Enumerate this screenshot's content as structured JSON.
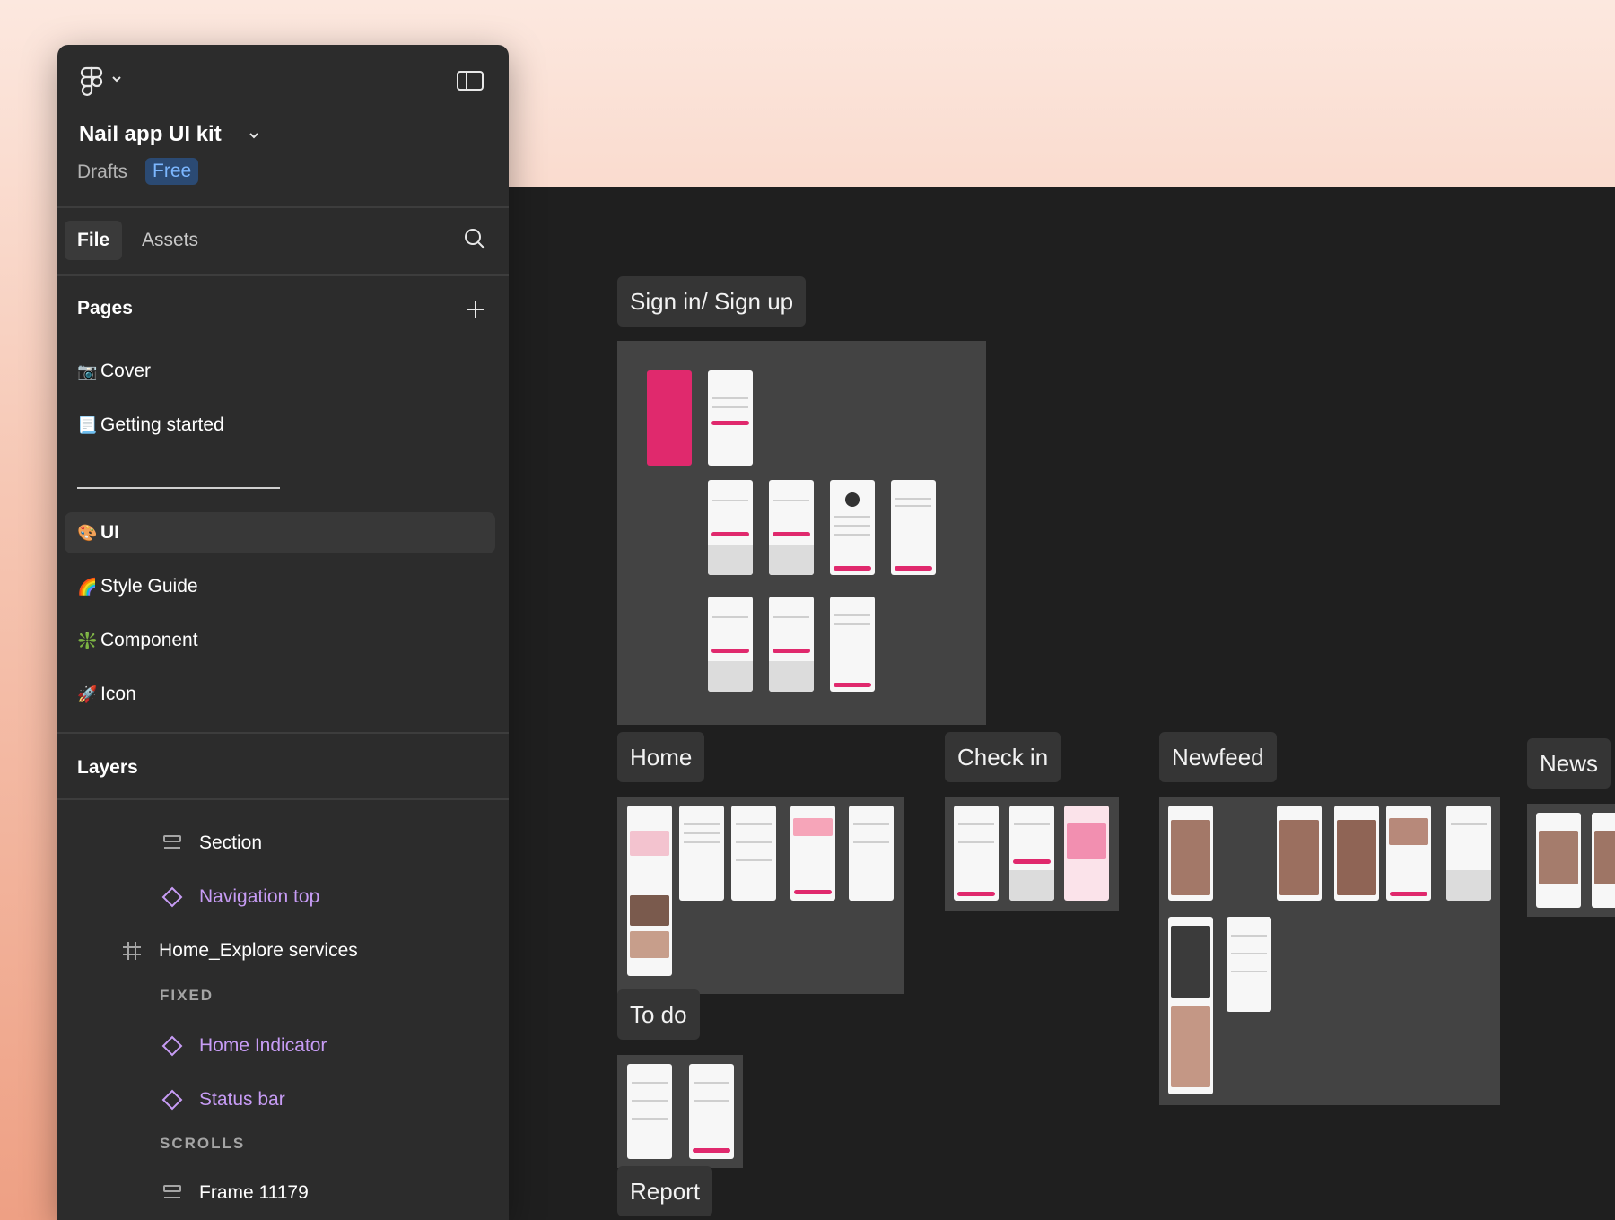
{
  "file": {
    "title": "Nail app UI kit",
    "location": "Drafts",
    "plan_badge": "Free"
  },
  "tabs": [
    {
      "label": "File"
    },
    {
      "label": "Assets"
    }
  ],
  "pages": {
    "heading": "Pages",
    "items": [
      {
        "icon": "📷",
        "label": "Cover"
      },
      {
        "icon": "📃",
        "label": "Getting started"
      },
      {
        "icon": "🎨",
        "label": "UI"
      },
      {
        "icon": "🌈",
        "label": "Style Guide"
      },
      {
        "icon": "❇️",
        "label": "Component"
      },
      {
        "icon": "🚀",
        "label": "Icon"
      }
    ],
    "active": "UI"
  },
  "layers": {
    "heading": "Layers",
    "items": [
      {
        "label": "Section",
        "icon": "section-icon"
      },
      {
        "label": "Navigation top",
        "icon": "component-instance-icon"
      },
      {
        "label": "Home_Explore services",
        "icon": "frame-icon"
      },
      {
        "label": "FIXED",
        "icon": ""
      },
      {
        "label": "Home Indicator",
        "icon": "component-instance-icon"
      },
      {
        "label": "Status bar",
        "icon": "component-instance-icon"
      },
      {
        "label": "SCROLLS",
        "icon": ""
      },
      {
        "label": "Frame 11179",
        "icon": "section-icon"
      }
    ]
  },
  "canvas": {
    "frames": [
      {
        "label": "Sign in/ Sign up"
      },
      {
        "label": "Home"
      },
      {
        "label": "Check in"
      },
      {
        "label": "Newfeed"
      },
      {
        "label": "News"
      },
      {
        "label": "To do"
      },
      {
        "label": "Report"
      }
    ]
  },
  "colors": {
    "accent_pink": "#e0296d",
    "component_purple": "#c79cf5",
    "badge_blue": "#7cb7ff",
    "canvas_bg": "#1f1f1f",
    "panel_bg": "#2c2c2c"
  }
}
